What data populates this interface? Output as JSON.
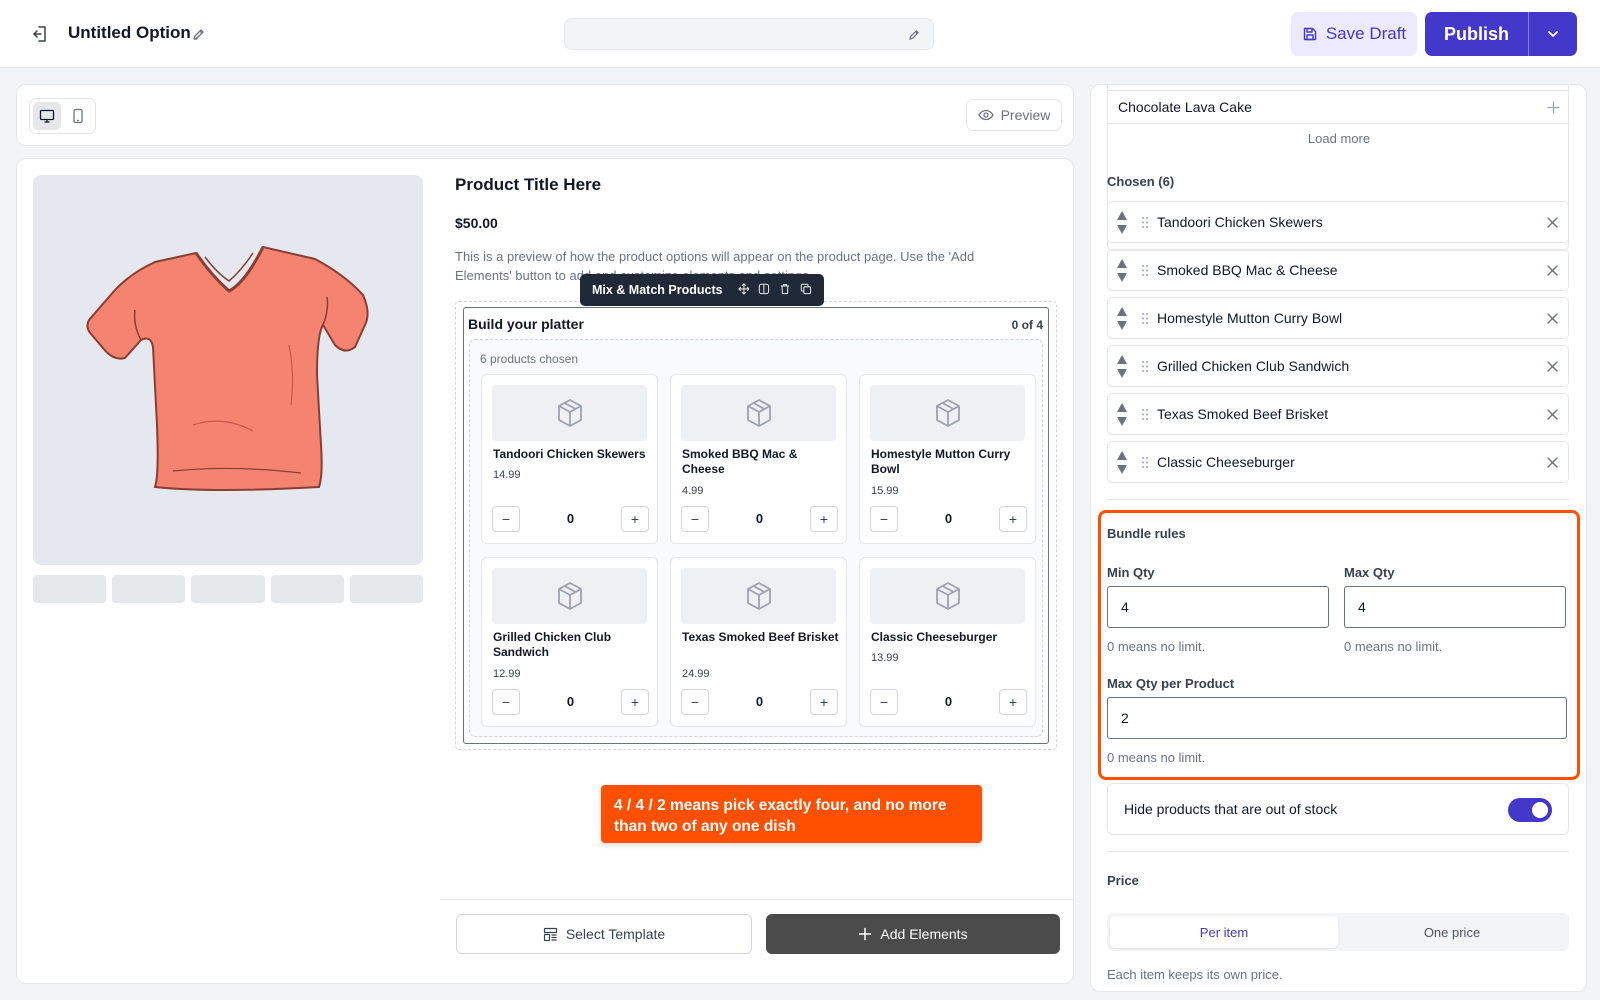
{
  "header": {
    "title": "Untitled Option",
    "save_draft_label": "Save Draft",
    "publish_label": "Publish"
  },
  "toolbar": {
    "preview_label": "Preview"
  },
  "product": {
    "title": "Product Title Here",
    "price": "$50.00",
    "description": "This is a preview of how the product options will appear on the product page. Use the 'Add Elements' button to add and customize elements and settings."
  },
  "element_toolbar": {
    "label": "Mix & Match Products"
  },
  "widget": {
    "title": "Build your platter",
    "counter": "0 of 4",
    "chosen_label": "6 products chosen",
    "products": [
      {
        "name": "Tandoori Chicken Skewers",
        "price": "14.99",
        "qty": "0"
      },
      {
        "name": "Smoked BBQ Mac & Cheese",
        "price": "4.99",
        "qty": "0"
      },
      {
        "name": "Homestyle Mutton Curry Bowl",
        "price": "15.99",
        "qty": "0"
      },
      {
        "name": "Grilled Chicken Club Sandwich",
        "price": "12.99",
        "qty": "0"
      },
      {
        "name": "Texas Smoked Beef Brisket",
        "price": "24.99",
        "qty": "0"
      },
      {
        "name": "Classic Cheeseburger",
        "price": "13.99",
        "qty": "0"
      }
    ],
    "minus": "−",
    "plus": "+"
  },
  "callout": {
    "text": "4 / 4 / 2 means pick exactly four, and no more than two of any one dish"
  },
  "bottom_bar": {
    "select_template": "Select Template",
    "add_elements": "Add Elements"
  },
  "panel": {
    "available_item": "Chocolate Lava Cake",
    "load_more": "Load more",
    "chosen_heading": "Chosen (6)",
    "chosen": [
      "Tandoori Chicken Skewers",
      "Smoked BBQ Mac & Cheese",
      "Homestyle Mutton Curry Bowl",
      "Grilled Chicken Club Sandwich",
      "Texas Smoked Beef Brisket",
      "Classic Cheeseburger"
    ],
    "rules": {
      "title": "Bundle rules",
      "min_label": "Min Qty",
      "min_value": "4",
      "min_help": "0 means no limit.",
      "max_label": "Max Qty",
      "max_value": "4",
      "max_help": "0 means no limit.",
      "per_label": "Max Qty per Product",
      "per_value": "2",
      "per_help": "0 means no limit."
    },
    "hide_oos": {
      "label": "Hide products that are out of stock",
      "enabled": true
    },
    "price": {
      "heading": "Price",
      "options": [
        "Per item",
        "One price"
      ],
      "selected": "Per item",
      "help": "Each item keeps its own price."
    }
  },
  "colors": {
    "accent": "#4338ca",
    "highlight": "#ff4f00",
    "shirt": "#f4836f"
  }
}
